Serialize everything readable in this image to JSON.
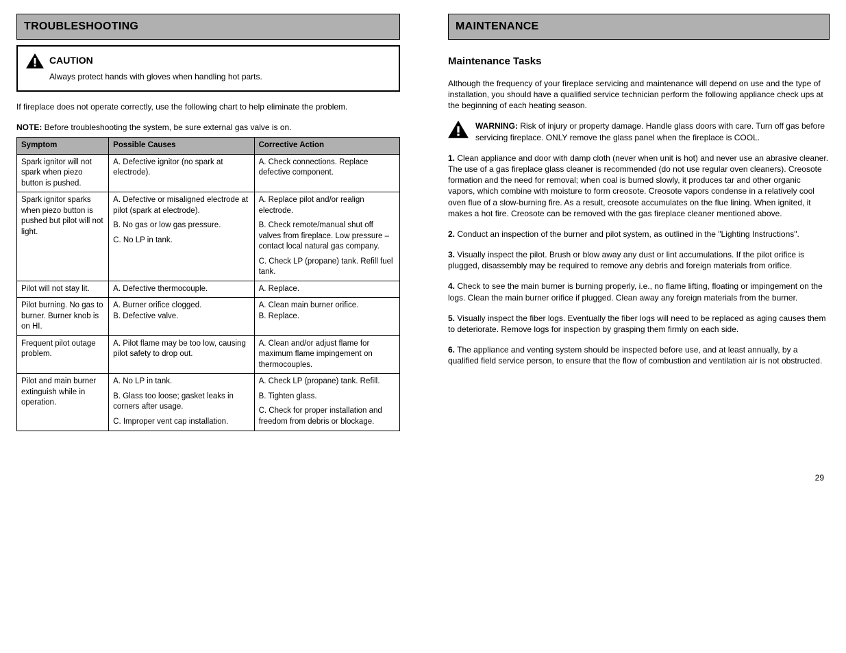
{
  "left": {
    "section_title": "TROUBLESHOOTING",
    "caution_label": "CAUTION",
    "caution_text": "Always protect hands with gloves when handling hot parts.",
    "intro": "If fireplace does not operate correctly, use the following chart to help eliminate the problem.",
    "note_label": "NOTE:",
    "note_text": " Before troubleshooting the system, be sure external gas valve is on.",
    "headers": [
      "Symptom",
      "Possible Causes",
      "Corrective Action"
    ],
    "rows": [
      {
        "a": "Spark ignitor will not spark when piezo button is pushed.",
        "b": [
          "A. Defective ignitor (no spark at electrode)."
        ],
        "c": [
          "A. Check connections. Replace defective component."
        ]
      },
      {
        "a": "Spark ignitor sparks when piezo button is pushed but pilot will not light.",
        "b": [
          "A. Defective or misaligned electrode at pilot (spark at electrode).",
          "B. No gas or low gas pressure.",
          "C. No LP in tank."
        ],
        "c": [
          "A. Replace pilot and/or realign electrode.",
          "B. Check remote/manual shut off valves from fireplace. Low pressure – contact local natural gas company.",
          "C. Check LP (propane) tank. Refill fuel tank."
        ]
      },
      {
        "a": "Pilot will not stay lit.",
        "b": [
          "A. Defective thermocouple."
        ],
        "c": [
          "A. Replace."
        ]
      },
      {
        "a": "Pilot burning. No gas to burner. Burner knob is on HI.",
        "b": [
          "A. Burner orifice clogged.",
          "B. Defective valve."
        ],
        "c": [
          "A. Clean main burner orifice.",
          "B. Replace."
        ]
      },
      {
        "a": "Frequent pilot outage problem.",
        "b": [
          "A. Pilot flame may be too low, causing pilot safety to drop out."
        ],
        "c": [
          "A. Clean and/or adjust flame for maximum flame impingement on thermocouples."
        ]
      },
      {
        "a": "Pilot and main burner extinguish while in operation.",
        "b": [
          "A. No LP in tank.",
          "B. Glass too loose; gasket leaks in corners after usage.",
          "C. Improper vent cap installation."
        ],
        "c": [
          "A. Check LP (propane) tank. Refill.",
          "B. Tighten glass.",
          "C. Check for proper installation and freedom from debris or blockage."
        ]
      }
    ]
  },
  "right": {
    "section_title": "MAINTENANCE",
    "sub_title": "Maintenance Tasks",
    "intro": "Although the frequency of your fireplace servicing and maintenance will depend on use and the type of installation, you should have a qualified service technician perform the following appliance check ups at the beginning of each heating season.",
    "warning_label": "WARNING:",
    "warning_text": " Risk of injury or property damage. Handle glass doors with care. Turn off gas before servicing fireplace. ONLY remove the glass panel when the fireplace is COOL.",
    "steps": [
      {
        "n": "1.",
        "t": "Clean appliance and door with damp cloth (never when unit is hot) and never use an abrasive cleaner. The use of a gas fireplace glass cleaner is recommended (do not use regular oven cleaners). Creosote formation and the need for removal; when coal is burned slowly, it produces tar and other organic vapors, which combine with moisture to form creosote. Creosote vapors condense in a relatively cool oven flue of a slow-burning fire. As a result, creosote accumulates on the flue lining. When ignited, it makes a hot fire. Creosote can be removed with the gas fireplace cleaner mentioned above."
      },
      {
        "n": "2.",
        "t": "Conduct an inspection of the burner and pilot system, as outlined in the \"Lighting Instructions\"."
      },
      {
        "n": "3.",
        "t": "Visually inspect the pilot. Brush or blow away any dust or lint accumulations. If the pilot orifice is plugged, disassembly may be required to remove any debris and foreign materials from orifice."
      },
      {
        "n": "4.",
        "t": "Check to see the main burner is burning properly, i.e., no flame lifting, floating or impingement on the logs. Clean the main burner orifice if plugged. Clean away any foreign materials from the burner."
      },
      {
        "n": "5.",
        "t": "Visually inspect the fiber logs. Eventually the fiber logs will need to be replaced as aging causes them to deteriorate. Remove logs for inspection by grasping them firmly on each side."
      },
      {
        "n": "6.",
        "t": "The appliance and venting system should be inspected before use, and at least annually, by a qualified field service person, to ensure that the flow of combustion and ventilation air is not obstructed."
      }
    ]
  },
  "page_number": "29"
}
